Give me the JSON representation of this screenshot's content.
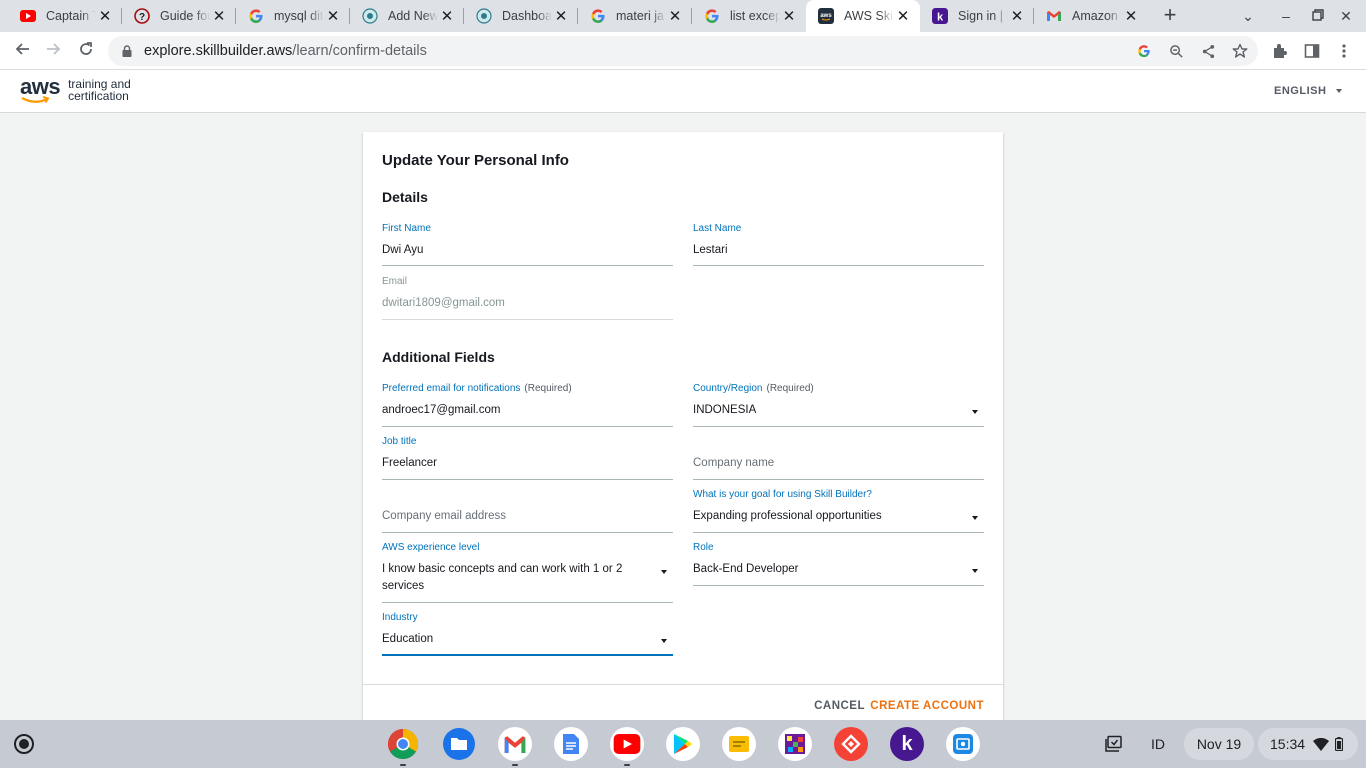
{
  "browser": {
    "tabs": [
      {
        "title": "Captain T"
      },
      {
        "title": "Guide for"
      },
      {
        "title": "mysql dit"
      },
      {
        "title": "Add New"
      },
      {
        "title": "Dashboa"
      },
      {
        "title": "materi ja"
      },
      {
        "title": "list excep"
      },
      {
        "title": "AWS Skill"
      },
      {
        "title": "Sign in | k"
      },
      {
        "title": "Amazon"
      }
    ],
    "url_host": "explore.skillbuilder.aws",
    "url_path": "/learn/confirm-details"
  },
  "header": {
    "logo_aws": "aws",
    "logo_line1": "training and",
    "logo_line2": "certification",
    "language": "ENGLISH"
  },
  "form": {
    "title": "Update Your Personal Info",
    "details_heading": "Details",
    "first_name": {
      "label": "First Name",
      "value": "Dwi Ayu"
    },
    "last_name": {
      "label": "Last Name",
      "value": "Lestari"
    },
    "email": {
      "label": "Email",
      "value": "dwitari1809@gmail.com"
    },
    "additional_heading": "Additional Fields",
    "pref_email": {
      "label": "Preferred email for notifications",
      "req": "(Required)",
      "value": "androec17@gmail.com"
    },
    "country": {
      "label": "Country/Region",
      "req": "(Required)",
      "value": "INDONESIA"
    },
    "job_title": {
      "label": "Job title",
      "value": "Freelancer"
    },
    "company_name": {
      "placeholder": "Company name"
    },
    "company_email": {
      "placeholder": "Company email address"
    },
    "goal": {
      "label": "What is your goal for using Skill Builder?",
      "value": "Expanding professional opportunities"
    },
    "aws_level": {
      "label": "AWS experience level",
      "value": "I know basic concepts and can work with 1 or 2 services"
    },
    "role": {
      "label": "Role",
      "value": "Back-End Developer"
    },
    "industry": {
      "label": "Industry",
      "value": "Education"
    },
    "cancel_label": "CANCEL",
    "create_label": "CREATE ACCOUNT"
  },
  "shelf": {
    "ime": "ID",
    "date": "Nov 19",
    "time": "15:34"
  }
}
